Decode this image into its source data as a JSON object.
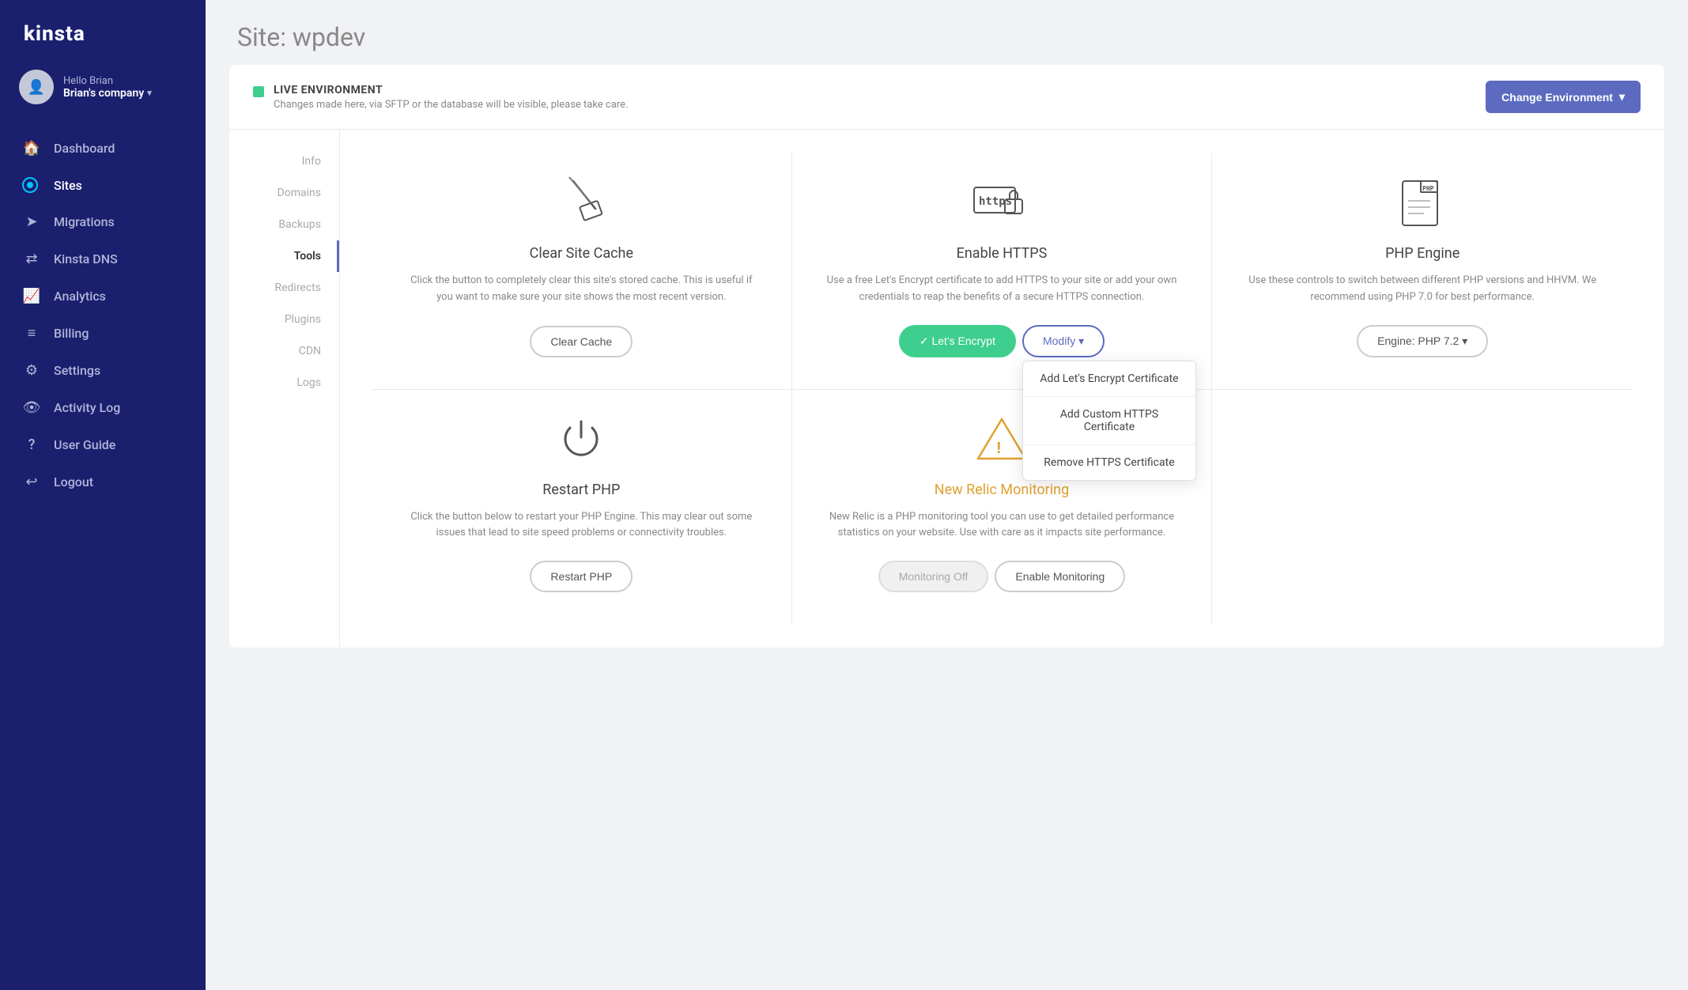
{
  "sidebar": {
    "logo": "kinsta",
    "user": {
      "hello": "Hello Brian",
      "company": "Brian's company"
    },
    "items": [
      {
        "id": "dashboard",
        "label": "Dashboard",
        "icon": "🏠"
      },
      {
        "id": "sites",
        "label": "Sites",
        "icon": "◉",
        "active": true
      },
      {
        "id": "migrations",
        "label": "Migrations",
        "icon": "➤"
      },
      {
        "id": "kinsta-dns",
        "label": "Kinsta DNS",
        "icon": "⇄"
      },
      {
        "id": "analytics",
        "label": "Analytics",
        "icon": "📈"
      },
      {
        "id": "billing",
        "label": "Billing",
        "icon": "≡"
      },
      {
        "id": "settings",
        "label": "Settings",
        "icon": "⚙"
      },
      {
        "id": "activity-log",
        "label": "Activity Log",
        "icon": "👁"
      },
      {
        "id": "user-guide",
        "label": "User Guide",
        "icon": "?"
      },
      {
        "id": "logout",
        "label": "Logout",
        "icon": "↩"
      }
    ]
  },
  "page": {
    "title": "Site: wpdev"
  },
  "env": {
    "badge": "LIVE ENVIRONMENT",
    "subtitle": "Changes made here, via SFTP or the database will be visible, please take care.",
    "change_btn": "Change Environment"
  },
  "sub_nav": {
    "items": [
      {
        "id": "info",
        "label": "Info"
      },
      {
        "id": "domains",
        "label": "Domains"
      },
      {
        "id": "backups",
        "label": "Backups"
      },
      {
        "id": "tools",
        "label": "Tools",
        "active": true
      },
      {
        "id": "redirects",
        "label": "Redirects"
      },
      {
        "id": "plugins",
        "label": "Plugins"
      },
      {
        "id": "cdn",
        "label": "CDN"
      },
      {
        "id": "logs",
        "label": "Logs"
      }
    ]
  },
  "tools": {
    "clear_cache": {
      "title": "Clear Site Cache",
      "desc": "Click the button to completely clear this site's stored cache. This is useful if you want to make sure your site shows the most recent version.",
      "btn": "Clear Cache"
    },
    "enable_https": {
      "title": "Enable HTTPS",
      "desc": "Use a free Let's Encrypt certificate to add HTTPS to your site or add your own credentials to reap the benefits of a secure HTTPS connection.",
      "btn_green": "✓  Let's Encrypt",
      "btn_modify": "Modify ▾",
      "dropdown": [
        {
          "label": "Add Let's Encrypt Certificate"
        },
        {
          "label": "Add Custom HTTPS Certificate"
        },
        {
          "label": "Remove HTTPS Certificate"
        }
      ]
    },
    "php_engine": {
      "title": "PHP Engine",
      "desc": "Use these controls to switch between different PHP versions and HHVM. We recommend using PHP 7.0 for best performance.",
      "btn": "Engine: PHP 7.2  ▾"
    },
    "restart_php": {
      "title": "Restart PHP",
      "desc": "Click the button below to restart your PHP Engine. This may clear out some issues that lead to site speed problems or connectivity troubles.",
      "btn": "Restart PHP"
    },
    "new_relic": {
      "title": "New Relic Monitoring",
      "desc": "New Relic is a PHP monitoring tool you can use to get detailed performance statistics on your website. Use with care as it impacts site performance.",
      "btn_off": "Monitoring Off",
      "btn_enable": "Enable Monitoring"
    }
  }
}
